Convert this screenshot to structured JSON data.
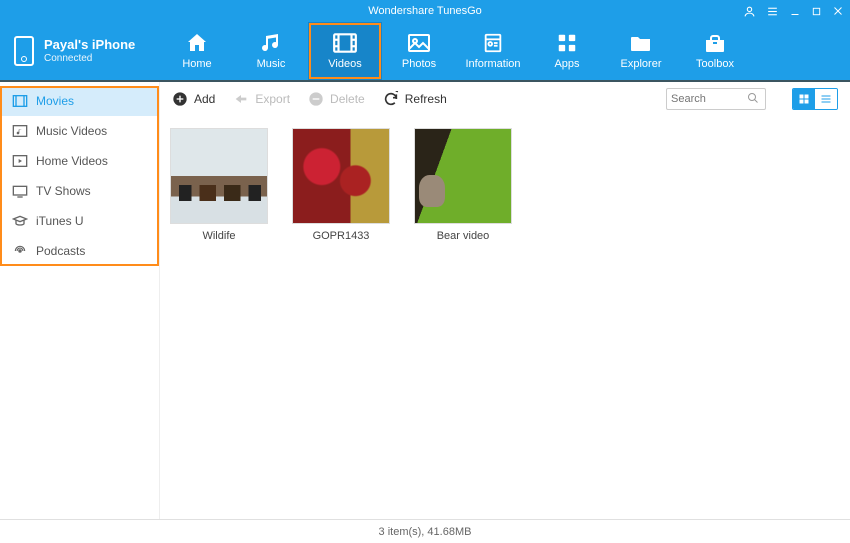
{
  "title": "Wondershare TunesGo",
  "device": {
    "name": "Payal's iPhone",
    "status": "Connected"
  },
  "nav": [
    {
      "label": "Home"
    },
    {
      "label": "Music"
    },
    {
      "label": "Videos",
      "active": true
    },
    {
      "label": "Photos"
    },
    {
      "label": "Information"
    },
    {
      "label": "Apps"
    },
    {
      "label": "Explorer"
    },
    {
      "label": "Toolbox"
    }
  ],
  "sidebar": [
    {
      "label": "Movies",
      "active": true
    },
    {
      "label": "Music Videos"
    },
    {
      "label": "Home Videos"
    },
    {
      "label": "TV Shows"
    },
    {
      "label": "iTunes U"
    },
    {
      "label": "Podcasts"
    }
  ],
  "toolbar": {
    "add": "Add",
    "export": "Export",
    "delete": "Delete",
    "refresh": "Refresh"
  },
  "search": {
    "placeholder": "Search"
  },
  "items": [
    {
      "name": "Wildife"
    },
    {
      "name": "GOPR1433"
    },
    {
      "name": "Bear video"
    }
  ],
  "status": "3 item(s), 41.68MB"
}
